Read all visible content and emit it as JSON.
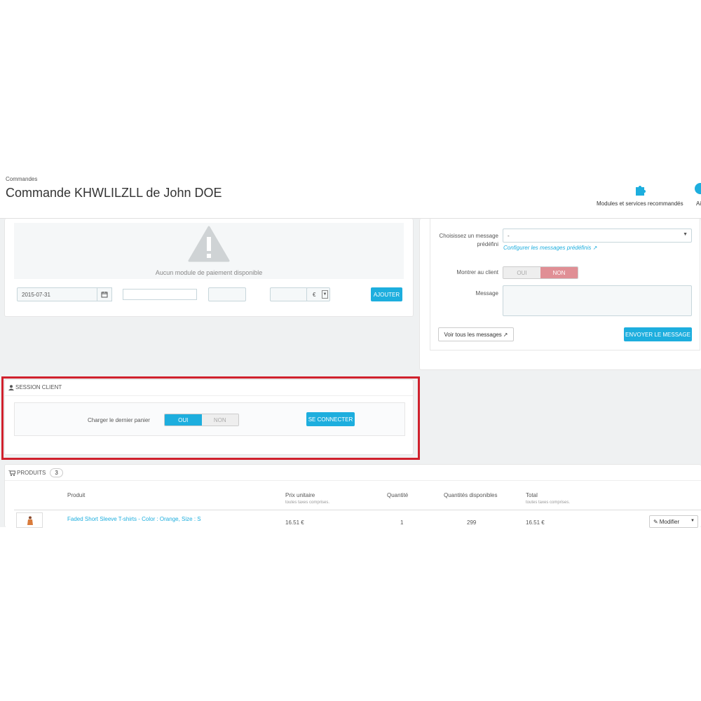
{
  "header": {
    "breadcrumb": "Commandes",
    "title": "Commande KHWLILZLL de John DOE",
    "toolbar": {
      "modules_label": "Modules et services recommandés",
      "help_label_partial": "Ai"
    }
  },
  "payment": {
    "empty_message": "Aucun module de paiement disponible",
    "date_value": "2015-07-31",
    "currency": "€",
    "add_button": "AJOUTER"
  },
  "messages": {
    "predefined_label": "Choisissez un message prédéfini",
    "predefined_value": "-",
    "configure_link": "Configurer les messages prédéfinis",
    "show_client_label": "Montrer au client",
    "oui": "OUI",
    "non": "NON",
    "message_label": "Message",
    "view_all_button": "Voir tous les messages",
    "send_button": "ENVOYER LE MESSAGE"
  },
  "session": {
    "heading": "SESSION CLIENT",
    "load_cart_label": "Charger le dernier panier",
    "oui": "OUI",
    "non": "NON",
    "connect_button": "SE CONNECTER"
  },
  "products": {
    "heading": "PRODUITS",
    "count": "3",
    "columns": {
      "product": "Produit",
      "unit_price": "Prix unitaire",
      "unit_price_sub": "toutes taxes comprises.",
      "quantity": "Quantité",
      "available": "Quantités disponibles",
      "total": "Total",
      "total_sub": "toutes taxes comprises."
    },
    "rows": [
      {
        "name": "Faded Short Sleeve T-shirts - Color : Orange, Size : S",
        "unit_price": "16.51 €",
        "quantity": "1",
        "available": "299",
        "total": "16.51 €",
        "action": "Modifier"
      }
    ]
  },
  "colors": {
    "accent": "#1daede",
    "danger": "#e08f95",
    "highlight_border": "#d0212d",
    "background": "#eff1f2"
  }
}
